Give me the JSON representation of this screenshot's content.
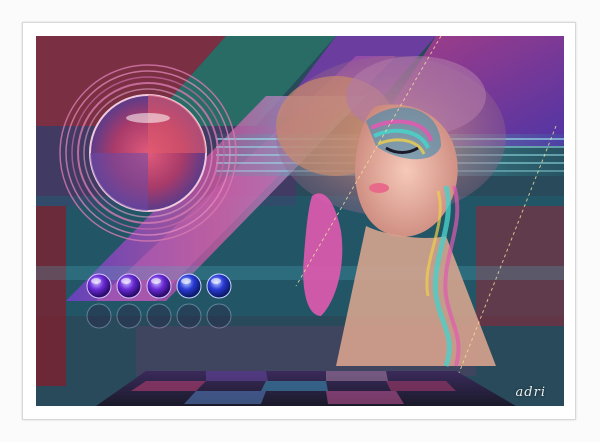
{
  "artwork": {
    "signature": "adri",
    "colors": {
      "magenta": "#d63aa8",
      "teal": "#1f8a86",
      "violet": "#6c3bd1",
      "crimson": "#a3203a",
      "sky": "#6fb6e6",
      "skin": "#f0b6a6",
      "hair": "#c98a6b"
    },
    "orbs_top_count": 5,
    "orbs_bottom_count": 5
  }
}
